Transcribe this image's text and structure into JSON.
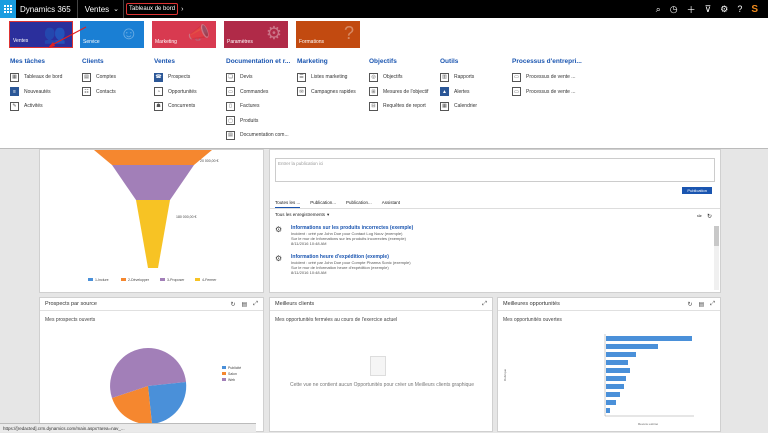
{
  "topbar": {
    "brand": "Dynamics 365",
    "module": "Ventes",
    "module_chevron": "⌄",
    "breadcrumb": "Tableaux de bord",
    "crumb_arrow": "›",
    "icons": [
      "search-icon",
      "history-icon",
      "add-icon",
      "filter-icon",
      "settings-icon",
      "help-icon",
      "brand-logo"
    ]
  },
  "tiles": [
    {
      "label": "Ventes",
      "color": "#2b2f9c"
    },
    {
      "label": "Service",
      "color": "#1a7fd4"
    },
    {
      "label": "Marketing",
      "color": "#d83a50"
    },
    {
      "label": "Paramètres",
      "color": "#b02a48"
    },
    {
      "label": "Formations",
      "color": "#c24a10"
    }
  ],
  "nav": {
    "groups": [
      {
        "title": "Mes tâches",
        "items": [
          "Tableaux de bord",
          "Nouveautés",
          "Activités"
        ]
      },
      {
        "title": "Clients",
        "items": [
          "Comptes",
          "Contacts"
        ]
      },
      {
        "title": "Ventes",
        "items": [
          "Prospects",
          "Opportunités",
          "Concurrents"
        ]
      },
      {
        "title": "Documentation et r...",
        "items": [
          "Devis",
          "Commandes",
          "Factures",
          "Produits",
          "Documentation com..."
        ]
      },
      {
        "title": "Marketing",
        "items": [
          "Listes marketing",
          "Campagnes rapides"
        ]
      },
      {
        "title": "Objectifs",
        "items": [
          "Objectifs",
          "Mesures de l'objectif",
          "Requêtes de report"
        ]
      },
      {
        "title": "Outils",
        "items": [
          "Rapports",
          "Alertes",
          "Calendrier"
        ]
      },
      {
        "title": "Processus d'entrepri...",
        "items": [
          "Processus de vente ...",
          "Processus de vente ..."
        ]
      }
    ]
  },
  "funnel": {
    "label_top": "20 000,00 €",
    "label_mid": "180 000,00 €",
    "legend": [
      "1-Inclure",
      "2-Développer",
      "3-Proposer",
      "4-Fermer"
    ],
    "colors": [
      "#4a90d9",
      "#f5872f",
      "#a27fb8",
      "#f7c324"
    ]
  },
  "activity": {
    "placeholder": "Entrer la publication ici",
    "publish_label": "Publication",
    "tabs": [
      "Toutes les ...",
      "Publication...",
      "Publication...",
      "Assistant"
    ],
    "filter_label": "Tous les enregistrements",
    "posts": [
      {
        "title": "Informations sur les produits incorrectes (exemple)",
        "line1": "Incident : créé par John Doe pour Contact Log Nouv (exemple)",
        "line2": "Sur le mur de Informations sur les produits incorrectes (exemple)",
        "date": "8/11/2016 10:48 AM"
      },
      {
        "title": "Information heure d'expédition (exemple)",
        "line1": "Incident : créé par John Doe pour Compte Pharma Sonic (exemple)",
        "line2": "Sur le mur de Information heure d'expédition (exemple)",
        "date": "8/11/2016 10:48 AM"
      }
    ]
  },
  "prospects": {
    "title": "Prospects par source",
    "subtitle": "Mes prospects ouverts",
    "legend": [
      "Publicité",
      "Salon",
      "Web"
    ],
    "colors": [
      "#4a90d9",
      "#f5872f",
      "#a27fb8"
    ]
  },
  "best_clients": {
    "title": "Meilleurs clients",
    "subtitle": "Mes opportunités fermées au cours de l'exercice actuel",
    "empty": "Cette vue ne contient aucun Opportunités pour créer un Meilleurs clients graphique"
  },
  "best_opps": {
    "title": "Meilleures opportunités",
    "subtitle": "Mes opportunités ouvertes",
    "xlabel": "Revenu estimé",
    "ylabel": "Rubrique",
    "color": "#4a90d9"
  },
  "status_url": "https://[redacted].crm.dynamics.com/main.aspx?area=nav_..."
}
